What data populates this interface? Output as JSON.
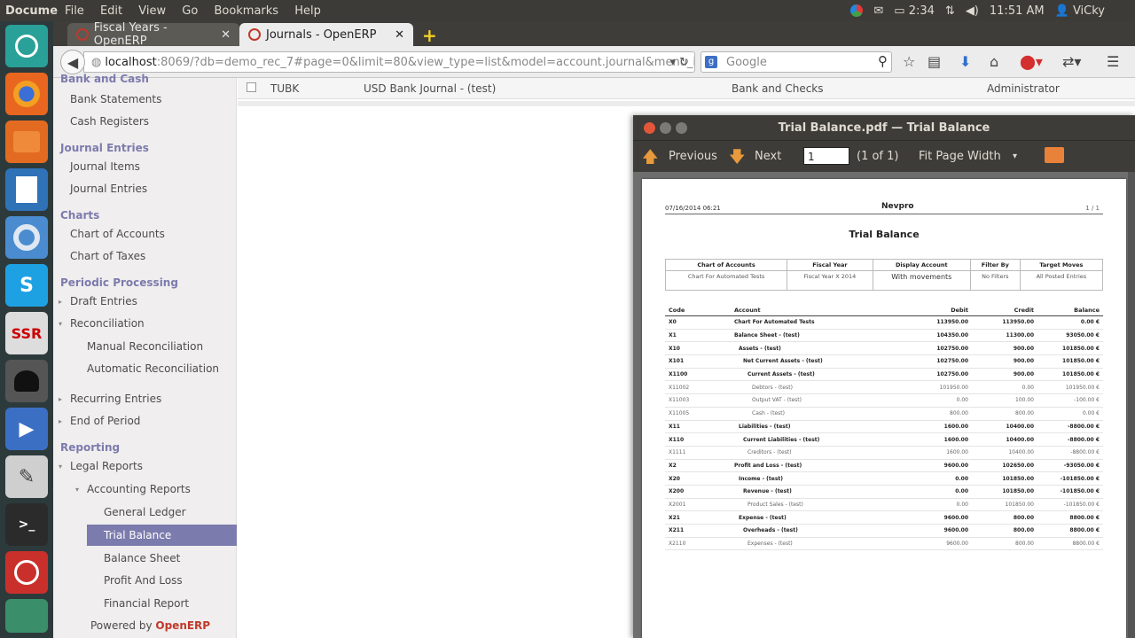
{
  "topbar": {
    "app_name": "Docume",
    "menus": [
      "File",
      "Edit",
      "View",
      "Go",
      "Bookmarks",
      "Help"
    ],
    "battery": "2:34",
    "clock": "11:51 AM",
    "user": "ViCky"
  },
  "browser": {
    "tabs": [
      {
        "title": "Fiscal Years - OpenERP",
        "active": false
      },
      {
        "title": "Journals - OpenERP",
        "active": true
      }
    ],
    "url_host": "localhost",
    "url_rest": ":8069/?db=demo_rec_7#page=0&limit=80&view_type=list&model=account.journal&menu_ic",
    "search_placeholder": "Google"
  },
  "sidebar": {
    "partial_top": "Bank and Cash",
    "items": [
      "Bank Statements",
      "Cash Registers",
      "Journal Entries",
      "Journal Items",
      "Journal Entries",
      "Charts",
      "Chart of Accounts",
      "Chart of Taxes",
      "Periodic Processing",
      "Draft Entries",
      "Reconciliation",
      "Manual Reconciliation",
      "Automatic Reconciliation",
      "Recurring Entries",
      "End of Period",
      "Reporting",
      "Legal Reports",
      "Accounting Reports",
      "General Ledger",
      "Trial Balance",
      "Balance Sheet",
      "Profit And Loss",
      "Financial Report"
    ],
    "selected": "Trial Balance",
    "powered_by": "Powered by",
    "powered_brand": "OpenERP"
  },
  "journal_row": {
    "code": "TUBK",
    "name": "USD Bank Journal - (test)",
    "type": "Bank and Checks",
    "user": "Administrator"
  },
  "pdf_viewer": {
    "window_title": "Trial Balance.pdf — Trial Balance",
    "prev_label": "Previous",
    "next_label": "Next",
    "page_value": "1",
    "page_count": "(1 of 1)",
    "zoom": "Fit Page Width"
  },
  "report": {
    "date": "07/16/2014  06:21",
    "company": "Nevpro",
    "page": "1 / 1",
    "title": "Trial Balance",
    "filter_headers": [
      "Chart of Accounts",
      "Fiscal Year",
      "Display Account",
      "Filter By",
      "Target Moves"
    ],
    "filter_values": [
      "Chart For Automated Tests",
      "Fiscal Year X 2014",
      "With movements",
      "No Filters",
      "All Posted Entries"
    ],
    "columns": [
      "Code",
      "Account",
      "Debit",
      "Credit",
      "Balance"
    ],
    "rows": [
      {
        "code": "X0",
        "account": "Chart For Automated Tests",
        "debit": "113950.00",
        "credit": "113950.00",
        "balance": "0.00 €",
        "bold": true,
        "indent": 0
      },
      {
        "code": "X1",
        "account": "Balance Sheet - (test)",
        "debit": "104350.00",
        "credit": "11300.00",
        "balance": "93050.00 €",
        "bold": true,
        "indent": 0
      },
      {
        "code": "X10",
        "account": "Assets - (test)",
        "debit": "102750.00",
        "credit": "900.00",
        "balance": "101850.00 €",
        "bold": true,
        "indent": 1
      },
      {
        "code": "X101",
        "account": "Net Current Assets - (test)",
        "debit": "102750.00",
        "credit": "900.00",
        "balance": "101850.00 €",
        "bold": true,
        "indent": 2
      },
      {
        "code": "X1100",
        "account": "Current Assets - (test)",
        "debit": "102750.00",
        "credit": "900.00",
        "balance": "101850.00 €",
        "bold": true,
        "indent": 3
      },
      {
        "code": "X11002",
        "account": "Debtors - (test)",
        "debit": "101950.00",
        "credit": "0.00",
        "balance": "101950.00 €",
        "bold": false,
        "indent": 4
      },
      {
        "code": "X11003",
        "account": "Output VAT - (test)",
        "debit": "0.00",
        "credit": "100.00",
        "balance": "-100.00 €",
        "bold": false,
        "indent": 4
      },
      {
        "code": "X11005",
        "account": "Cash - (test)",
        "debit": "800.00",
        "credit": "800.00",
        "balance": "0.00 €",
        "bold": false,
        "indent": 4
      },
      {
        "code": "X11",
        "account": "Liabilities - (test)",
        "debit": "1600.00",
        "credit": "10400.00",
        "balance": "-8800.00 €",
        "bold": true,
        "indent": 1
      },
      {
        "code": "X110",
        "account": "Current Liabilities - (test)",
        "debit": "1600.00",
        "credit": "10400.00",
        "balance": "-8800.00 €",
        "bold": true,
        "indent": 2
      },
      {
        "code": "X1111",
        "account": "Creditors - (test)",
        "debit": "1600.00",
        "credit": "10400.00",
        "balance": "-8800.00 €",
        "bold": false,
        "indent": 3
      },
      {
        "code": "X2",
        "account": "Profit and Loss - (test)",
        "debit": "9600.00",
        "credit": "102650.00",
        "balance": "-93050.00 €",
        "bold": true,
        "indent": 0
      },
      {
        "code": "X20",
        "account": "Income - (test)",
        "debit": "0.00",
        "credit": "101850.00",
        "balance": "-101850.00 €",
        "bold": true,
        "indent": 1
      },
      {
        "code": "X200",
        "account": "Revenue - (test)",
        "debit": "0.00",
        "credit": "101850.00",
        "balance": "-101850.00 €",
        "bold": true,
        "indent": 2
      },
      {
        "code": "X2001",
        "account": "Product Sales - (test)",
        "debit": "0.00",
        "credit": "101850.00",
        "balance": "-101850.00 €",
        "bold": false,
        "indent": 3
      },
      {
        "code": "X21",
        "account": "Expense - (test)",
        "debit": "9600.00",
        "credit": "800.00",
        "balance": "8800.00 €",
        "bold": true,
        "indent": 1
      },
      {
        "code": "X211",
        "account": "Overheads - (test)",
        "debit": "9600.00",
        "credit": "800.00",
        "balance": "8800.00 €",
        "bold": true,
        "indent": 2
      },
      {
        "code": "X2110",
        "account": "Expenses - (test)",
        "debit": "9600.00",
        "credit": "800.00",
        "balance": "8800.00 €",
        "bold": false,
        "indent": 3
      }
    ]
  }
}
